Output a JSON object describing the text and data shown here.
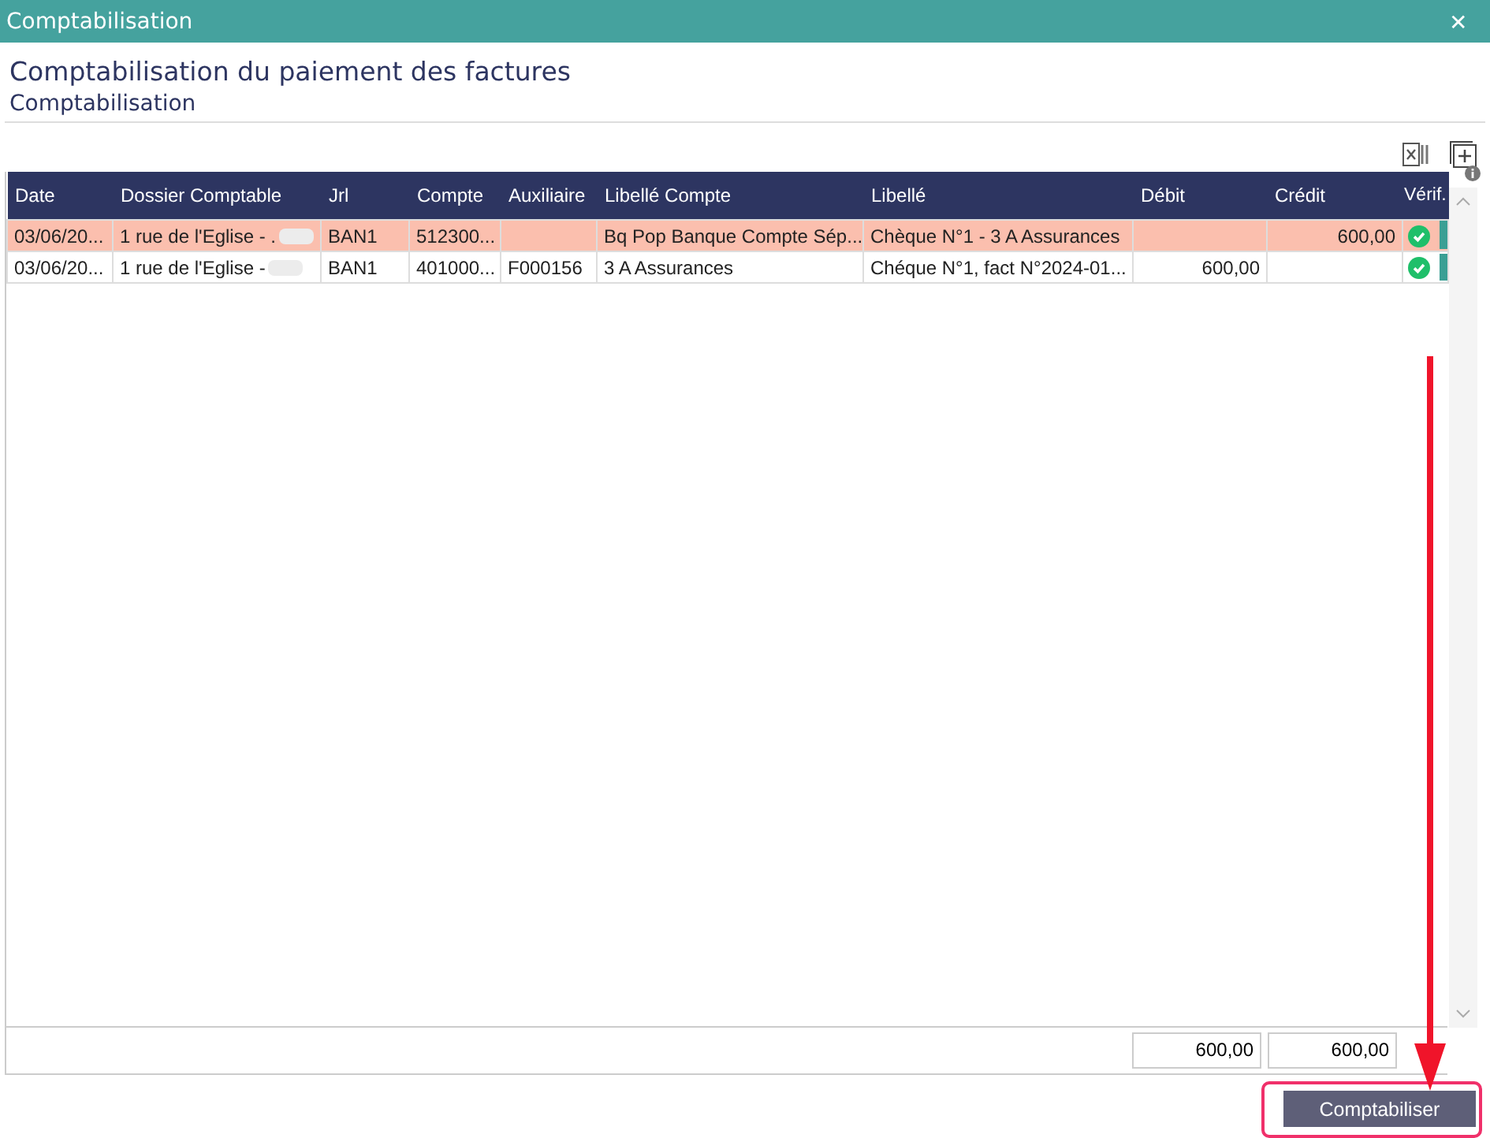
{
  "window": {
    "title": "Comptabilisation",
    "close": "✕"
  },
  "heading": "Comptabilisation du paiement des factures",
  "subheading": "Comptabilisation",
  "table": {
    "columns": [
      "Date",
      "Dossier Comptable",
      "Jrl",
      "Compte",
      "Auxiliaire",
      "Libellé Compte",
      "Libellé",
      "Débit",
      "Crédit",
      "Vérif."
    ],
    "rows": [
      {
        "selected": true,
        "verified": true,
        "cells": [
          "03/06/20...",
          "1 rue de l'Eglise - .",
          "BAN1",
          "512300...",
          "",
          "Bq Pop Banque Compte Sép...",
          "Chèque N°1 - 3 A Assurances",
          "",
          "600,00"
        ]
      },
      {
        "selected": false,
        "verified": true,
        "cells": [
          "03/06/20...",
          "1 rue de l'Eglise -",
          "BAN1",
          "401000...",
          "F000156",
          "3 A Assurances",
          "Chéque N°1, fact N°2024-01...",
          "600,00",
          ""
        ]
      }
    ],
    "totals": [
      "600,00",
      "600,00"
    ]
  },
  "button": "Comptabiliser"
}
